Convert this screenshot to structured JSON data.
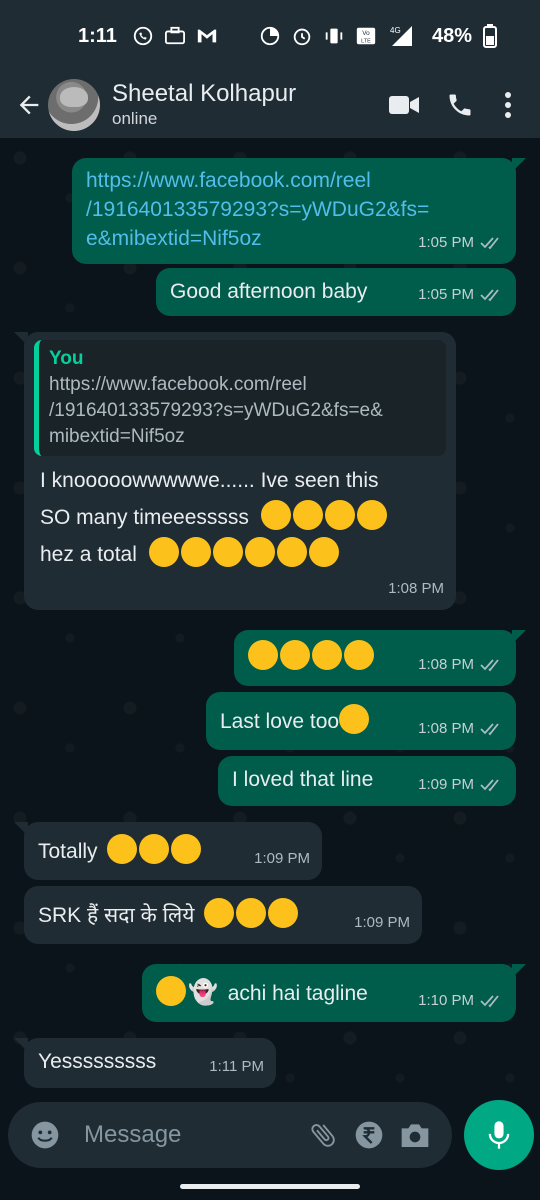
{
  "status_bar": {
    "time": "1:11",
    "battery": "48%",
    "network": "4G"
  },
  "header": {
    "contact_name": "Sheetal Kolhapur",
    "contact_status": "online"
  },
  "messages": [
    {
      "dir": "out",
      "text_lines": [
        "https://www.facebook.com/reel",
        "/191640133579293?s=yWDuG2&fs=",
        "e&mibextid=Nif5oz"
      ],
      "time": "1:05 PM",
      "is_link": true
    },
    {
      "dir": "out",
      "text": "Good afternoon baby",
      "time": "1:05 PM"
    },
    {
      "dir": "in",
      "quote_author": "You",
      "quote_lines": [
        "https://www.facebook.com/reel",
        "/191640133579293?s=yWDuG2&fs=e&",
        "mibextid=Nif5oz"
      ],
      "text_line1": "I knooooowwwwwe...... Ive seen this",
      "text_line2": "SO many timeeesssss",
      "text_line3": "hez a total",
      "time": "1:08 PM"
    },
    {
      "dir": "out",
      "text": "",
      "time": "1:08 PM"
    },
    {
      "dir": "out",
      "text": "Last love too",
      "time": "1:08 PM"
    },
    {
      "dir": "out",
      "text": "I loved that line",
      "time": "1:09 PM"
    },
    {
      "dir": "in",
      "text": "Totally",
      "time": "1:09 PM"
    },
    {
      "dir": "in",
      "text": "SRK हैं सदा के लिये",
      "time": "1:09 PM"
    },
    {
      "dir": "out",
      "text": "achi hai tagline",
      "time": "1:10 PM"
    },
    {
      "dir": "in",
      "text": "Yesssssssss",
      "time": "1:11 PM"
    }
  ],
  "input": {
    "placeholder": "Message"
  },
  "colors": {
    "outgoing_bubble": "#005c4b",
    "incoming_bubble": "#202c33",
    "accent": "#00a884",
    "quote_accent": "#06cf9c",
    "link": "#53bdeb"
  },
  "icons": [
    "back-arrow-icon",
    "video-call-icon",
    "phone-icon",
    "more-vert-icon",
    "emoji-icon",
    "attach-icon",
    "rupee-icon",
    "camera-icon",
    "mic-icon",
    "double-tick-icon"
  ]
}
